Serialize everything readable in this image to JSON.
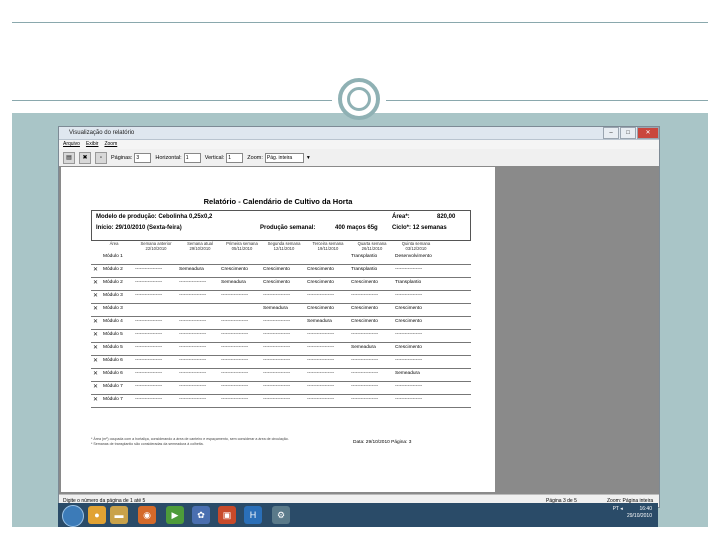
{
  "window": {
    "title": "Visualização do relatório"
  },
  "menu": [
    "Arquivo",
    "Exibir",
    "Zoom"
  ],
  "toolbar": {
    "pages_label": "Páginas:",
    "pages_value": "3",
    "horizontal_label": "Horizontal:",
    "horizontal_value": "1",
    "vertical_label": "Vertical:",
    "vertical_value": "1",
    "zoom_label": "Zoom:",
    "zoom_value": "Pág. inteira"
  },
  "report": {
    "title": "Relatório - Calendário de Cultivo da Horta",
    "model_label": "Modelo de produção: Cebolinha 0,25x0,2",
    "area_label": "Área*:",
    "area_value": "820,00",
    "start_label": "Início: 29/10/2010 (Sexta-feira)",
    "weekly_label": "Produção semanal:",
    "weekly_value": "400 maços 65g",
    "cycle_label": "Ciclo*: 12 semanas",
    "col_headers": [
      "Área",
      "Semana anterior 22/10/2010",
      "Semana atual 29/10/2010",
      "Primeira semana 05/11/2010",
      "Segunda semana 12/11/2010",
      "Terceira semana 19/11/2010",
      "Quarta semana 26/11/2010",
      "Quinta semana 03/12/2010"
    ],
    "rows": [
      {
        "checked": false,
        "label": "Módulo 1",
        "cells": [
          "",
          "",
          "",
          "",
          "",
          "Transplantio",
          "Desenvolvimento"
        ]
      },
      {
        "checked": true,
        "label": "Módulo 2",
        "cells": [
          "-----------------",
          "Semeadura",
          "Crescimento",
          "Crescimento",
          "Crescimento",
          "Transplantio",
          "-----------------"
        ]
      },
      {
        "checked": true,
        "label": "Módulo 2",
        "cells": [
          "-----------------",
          "-----------------",
          "Semeadura",
          "Crescimento",
          "Crescimento",
          "Crescimento",
          "Transplantio"
        ]
      },
      {
        "checked": true,
        "label": "Módulo 3",
        "cells": [
          "-----------------",
          "-----------------",
          "-----------------",
          "-----------------",
          "-----------------",
          "-----------------",
          "-----------------"
        ]
      },
      {
        "checked": true,
        "label": "Módulo 3",
        "cells": [
          "",
          "",
          "",
          "Semeadura",
          "Crescimento",
          "Crescimento",
          "Crescimento"
        ]
      },
      {
        "checked": true,
        "label": "Módulo 4",
        "cells": [
          "-----------------",
          "-----------------",
          "-----------------",
          "-----------------",
          "Semeadura",
          "Crescimento",
          "Crescimento"
        ]
      },
      {
        "checked": true,
        "label": "Módulo 5",
        "cells": [
          "-----------------",
          "-----------------",
          "-----------------",
          "-----------------",
          "-----------------",
          "-----------------",
          "-----------------"
        ]
      },
      {
        "checked": true,
        "label": "Módulo 5",
        "cells": [
          "-----------------",
          "-----------------",
          "-----------------",
          "-----------------",
          "-----------------",
          "Semeadura",
          "Crescimento"
        ]
      },
      {
        "checked": true,
        "label": "Módulo 6",
        "cells": [
          "-----------------",
          "-----------------",
          "-----------------",
          "-----------------",
          "-----------------",
          "-----------------",
          "-----------------"
        ]
      },
      {
        "checked": true,
        "label": "Módulo 6",
        "cells": [
          "-----------------",
          "-----------------",
          "-----------------",
          "-----------------",
          "-----------------",
          "-----------------",
          "Semeadura"
        ]
      },
      {
        "checked": true,
        "label": "Módulo 7",
        "cells": [
          "-----------------",
          "-----------------",
          "-----------------",
          "-----------------",
          "-----------------",
          "-----------------",
          "-----------------"
        ]
      },
      {
        "checked": true,
        "label": "Módulo 7",
        "cells": [
          "-----------------",
          "-----------------",
          "-----------------",
          "-----------------",
          "-----------------",
          "-----------------",
          "-----------------"
        ]
      }
    ],
    "date": "Data: 29/10/2010   Página: 3"
  },
  "status": {
    "left": "Digite o número da página de 1 até 5",
    "middle": "Página 3 de 5",
    "right": "Zoom: Página inteira"
  },
  "taskbar": {
    "lang": "PT",
    "time": "16:40",
    "date": "29/10/2010"
  },
  "colors": {
    "accent": "#8fb1b4",
    "band": "#a9c5c7",
    "taskbar": "#2a4b68"
  }
}
